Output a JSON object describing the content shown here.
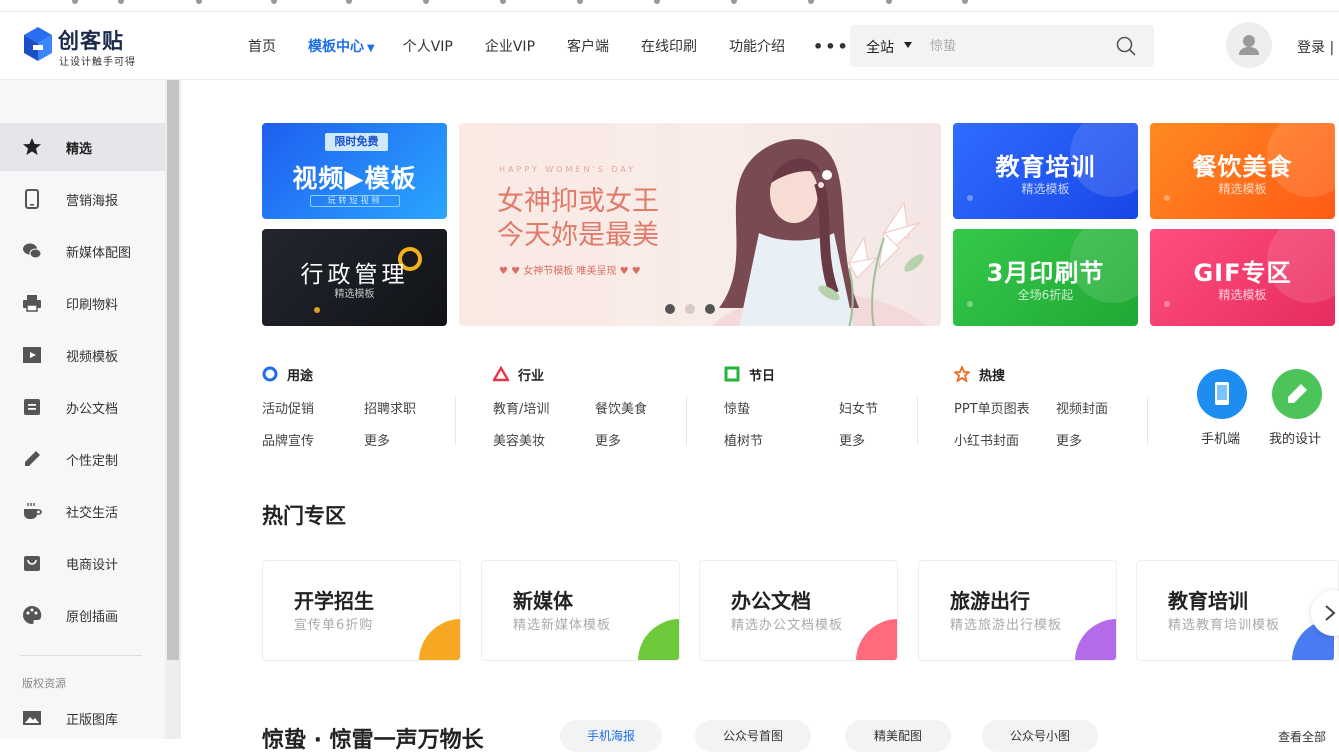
{
  "brand": {
    "name": "创客贴",
    "slogan": "让设计触手可得"
  },
  "nav": {
    "items": [
      "首页",
      "模板中心",
      "个人VIP",
      "企业VIP",
      "客户端",
      "在线印刷",
      "功能介绍"
    ],
    "more": "•••"
  },
  "search": {
    "scope": "全站",
    "placeholder": "惊蛰"
  },
  "login": "登录 |",
  "sidebar": {
    "items": [
      {
        "label": "精选",
        "icon": "star-icon"
      },
      {
        "label": "营销海报",
        "icon": "phone-icon"
      },
      {
        "label": "新媒体配图",
        "icon": "wechat-icon"
      },
      {
        "label": "印刷物料",
        "icon": "printer-icon"
      },
      {
        "label": "视频模板",
        "icon": "video-icon"
      },
      {
        "label": "办公文档",
        "icon": "document-icon"
      },
      {
        "label": "个性定制",
        "icon": "pencil-icon"
      },
      {
        "label": "社交生活",
        "icon": "coffee-icon"
      },
      {
        "label": "电商设计",
        "icon": "shop-icon"
      },
      {
        "label": "原创插画",
        "icon": "palette-icon"
      }
    ],
    "section_label": "版权资源",
    "resource_item": {
      "label": "正版图库",
      "icon": "image-icon"
    }
  },
  "banners": {
    "video": {
      "badge": "限时免费",
      "title": "视频▶模板",
      "sub": "玩转短视频"
    },
    "admin": {
      "title": "行政管理",
      "sub": "精选模板"
    },
    "hero": {
      "eyebrow": "HAPPY WOMEN'S DAY",
      "line1": "女神抑或女王",
      "line2": "今天妳是最美",
      "caption": "♥ ♥  女神节模板 唯美呈现  ♥ ♥"
    },
    "education": {
      "title": "教育培训",
      "sub": "精选模板"
    },
    "food": {
      "title": "餐饮美食",
      "sub": "精选模板"
    },
    "print": {
      "title": "3月印刷节",
      "sub": "全场6折起"
    },
    "gif": {
      "title": "GIF专区",
      "sub": "精选模板"
    }
  },
  "quick": {
    "usage": {
      "title": "用途",
      "links": [
        "活动促销",
        "招聘求职",
        "品牌宣传",
        "更多"
      ]
    },
    "industry": {
      "title": "行业",
      "links": [
        "教育/培训",
        "餐饮美食",
        "美容美妆",
        "更多"
      ]
    },
    "festival": {
      "title": "节日",
      "links": [
        "惊蛰",
        "妇女节",
        "植树节",
        "更多"
      ]
    },
    "hot": {
      "title": "热搜",
      "links": [
        "PPT单页图表",
        "视频封面",
        "小红书封面",
        "更多"
      ]
    },
    "mobile": "手机端",
    "mydesign": "我的设计"
  },
  "hot_section": {
    "title": "热门专区",
    "cards": [
      {
        "title": "开学招生",
        "sub": "宣传单6折购",
        "color": "#f7a823"
      },
      {
        "title": "新媒体",
        "sub": "精选新媒体模板",
        "color": "#6ec93a"
      },
      {
        "title": "办公文档",
        "sub": "精选办公文档模板",
        "color": "#ff6b7d"
      },
      {
        "title": "旅游出行",
        "sub": "精选旅游出行模板",
        "color": "#b36bea"
      },
      {
        "title": "教育培训",
        "sub": "精选教育培训模板",
        "color": "#4a7bf0"
      }
    ]
  },
  "bottom": {
    "title": "惊蛰 · 惊雷一声万物长",
    "pills": [
      "手机海报",
      "公众号首图",
      "精美配图",
      "公众号小图"
    ],
    "more": "查看全部"
  }
}
